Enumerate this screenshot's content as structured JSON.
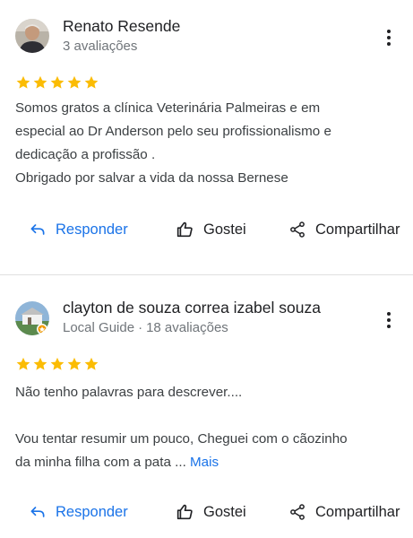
{
  "reviews": [
    {
      "author": "Renato Resende",
      "subtitle": "3 avaliações",
      "local_guide": "",
      "rating": 5,
      "text_lines": [
        "Somos gratos a clínica Veterinária Palmeiras e em",
        "especial ao Dr Anderson pelo seu profissionalismo e",
        "dedicação a profissão .",
        "Obrigado por salvar a vida da nossa Bernese"
      ],
      "more_label": "",
      "actions": {
        "reply": "Responder",
        "like": "Gostei",
        "share": "Compartilhar"
      }
    },
    {
      "author": "clayton de souza correa izabel souza",
      "local_guide": "Local Guide",
      "separator": "·",
      "subtitle": "18 avaliações",
      "rating": 5,
      "text_lines": [
        "Não tenho palavras para descrever....",
        "",
        "Vou tentar resumir um pouco, Cheguei com o cãozinho",
        "da minha filha com a pata ..."
      ],
      "more_label": "Mais",
      "actions": {
        "reply": "Responder",
        "like": "Gostei",
        "share": "Compartilhar"
      }
    }
  ],
  "colors": {
    "star": "#fbbc04",
    "link": "#1a73e8",
    "secondary_text": "#70757a",
    "divider": "#e0e0e0",
    "local_guide_badge": "#f29900"
  },
  "icons": {
    "menu": "more-vert-icon",
    "reply": "reply-arrow-icon",
    "like": "thumb-up-icon",
    "share": "share-icon",
    "star": "star-icon"
  }
}
